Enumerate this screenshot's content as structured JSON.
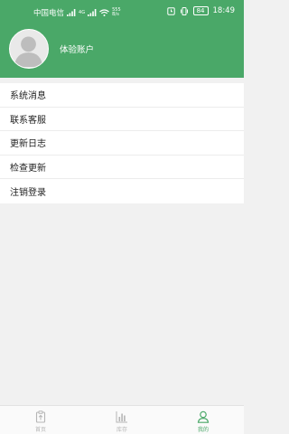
{
  "status_bar": {
    "carrier": "中国电信",
    "network_label": "4G",
    "network_speed_value": "555",
    "network_speed_unit": "B/s",
    "battery": "84",
    "time": "18:49"
  },
  "colors": {
    "accent": "#4aa868",
    "inactive": "#b5b5b5"
  },
  "profile": {
    "username": "体验账户"
  },
  "menu": {
    "items": [
      {
        "label": "系统消息"
      },
      {
        "label": "联系客服"
      },
      {
        "label": "更新日志"
      },
      {
        "label": "检查更新"
      },
      {
        "label": "注销登录"
      }
    ]
  },
  "tabbar": {
    "tabs": [
      {
        "label": "首页",
        "icon": "home-icon"
      },
      {
        "label": "库存",
        "icon": "inventory-chart-icon"
      },
      {
        "label": "我的",
        "icon": "user-icon",
        "active": true
      }
    ]
  }
}
